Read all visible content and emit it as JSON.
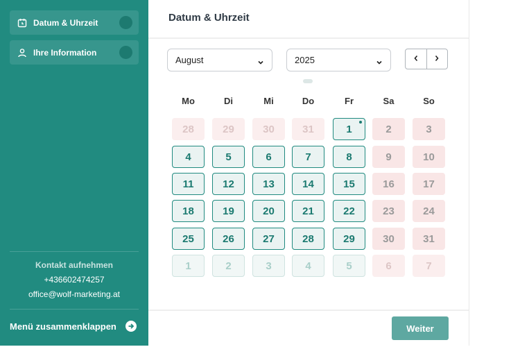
{
  "sidebar": {
    "items": [
      {
        "label": "Datum & Uhrzeit",
        "icon": "calendar-clock-icon"
      },
      {
        "label": "Ihre Information",
        "icon": "user-icon"
      }
    ],
    "contact": {
      "heading": "Kontakt aufnehmen",
      "phone": "+436602474257",
      "email": "office@wolf-marketing.at"
    },
    "collapse_label": "Menü zusammenklappen",
    "collapse_icon": "arrow-right-circle-icon"
  },
  "main": {
    "title": "Datum & Uhrzeit",
    "month_value": "August",
    "year_value": "2025",
    "prev_icon": "chevron-left-icon",
    "next_icon": "chevron-right-icon",
    "weekdays": [
      "Mo",
      "Di",
      "Mi",
      "Do",
      "Fr",
      "Sa",
      "So"
    ],
    "weeks": [
      [
        {
          "d": "28",
          "s": "redfaded"
        },
        {
          "d": "29",
          "s": "redfaded"
        },
        {
          "d": "30",
          "s": "redfaded"
        },
        {
          "d": "31",
          "s": "redfaded"
        },
        {
          "d": "1",
          "s": "avail",
          "today": true
        },
        {
          "d": "2",
          "s": "red"
        },
        {
          "d": "3",
          "s": "red"
        }
      ],
      [
        {
          "d": "4",
          "s": "avail"
        },
        {
          "d": "5",
          "s": "avail"
        },
        {
          "d": "6",
          "s": "avail"
        },
        {
          "d": "7",
          "s": "avail"
        },
        {
          "d": "8",
          "s": "avail"
        },
        {
          "d": "9",
          "s": "red"
        },
        {
          "d": "10",
          "s": "red"
        }
      ],
      [
        {
          "d": "11",
          "s": "avail"
        },
        {
          "d": "12",
          "s": "avail"
        },
        {
          "d": "13",
          "s": "avail"
        },
        {
          "d": "14",
          "s": "avail"
        },
        {
          "d": "15",
          "s": "avail"
        },
        {
          "d": "16",
          "s": "red"
        },
        {
          "d": "17",
          "s": "red"
        }
      ],
      [
        {
          "d": "18",
          "s": "avail"
        },
        {
          "d": "19",
          "s": "avail"
        },
        {
          "d": "20",
          "s": "avail"
        },
        {
          "d": "21",
          "s": "avail"
        },
        {
          "d": "22",
          "s": "avail"
        },
        {
          "d": "23",
          "s": "red"
        },
        {
          "d": "24",
          "s": "red"
        }
      ],
      [
        {
          "d": "25",
          "s": "avail"
        },
        {
          "d": "26",
          "s": "avail"
        },
        {
          "d": "27",
          "s": "avail"
        },
        {
          "d": "28",
          "s": "avail"
        },
        {
          "d": "29",
          "s": "avail"
        },
        {
          "d": "30",
          "s": "red"
        },
        {
          "d": "31",
          "s": "red"
        }
      ],
      [
        {
          "d": "1",
          "s": "faded"
        },
        {
          "d": "2",
          "s": "faded"
        },
        {
          "d": "3",
          "s": "faded"
        },
        {
          "d": "4",
          "s": "faded"
        },
        {
          "d": "5",
          "s": "faded"
        },
        {
          "d": "6",
          "s": "redfaded"
        },
        {
          "d": "7",
          "s": "redfaded"
        }
      ]
    ],
    "next_button_label": "Weiter"
  },
  "colors": {
    "sidebar_bg": "#218b80",
    "accent": "#1f8a7f",
    "unavailable_bg": "#f9e6e6",
    "primary_button": "#5ea8a1"
  }
}
